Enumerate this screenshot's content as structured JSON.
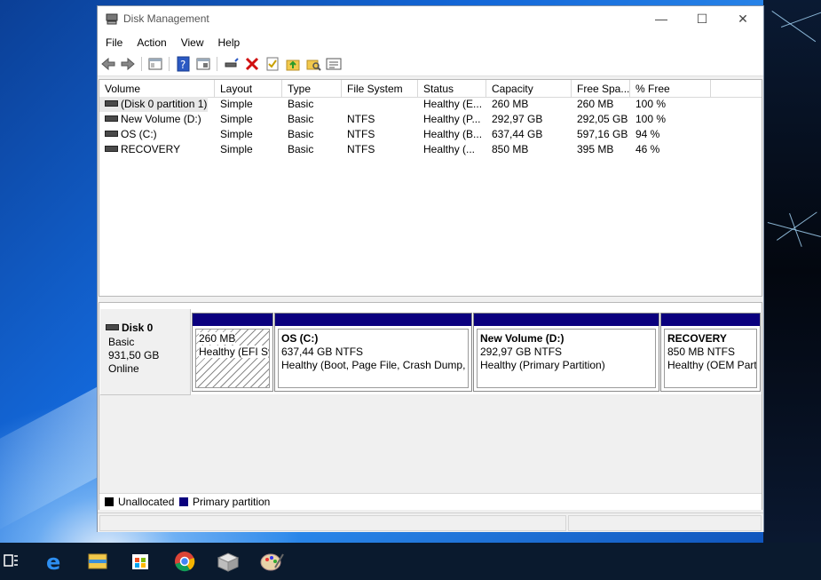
{
  "window": {
    "title": "Disk Management",
    "menu": [
      "File",
      "Action",
      "View",
      "Help"
    ]
  },
  "toolbar": {
    "icons": [
      "back-icon",
      "forward-icon",
      "console-tree-icon",
      "help-icon",
      "properties-icon",
      "connect-icon",
      "delete-icon",
      "check-icon",
      "folder-up-icon",
      "search-folder-icon",
      "list-icon"
    ]
  },
  "volume_list": {
    "columns": [
      "Volume",
      "Layout",
      "Type",
      "File System",
      "Status",
      "Capacity",
      "Free Spa...",
      "% Free"
    ],
    "rows": [
      {
        "volume": "(Disk 0 partition 1)",
        "layout": "Simple",
        "type": "Basic",
        "fs": "",
        "status": "Healthy (E...",
        "capacity": "260 MB",
        "free": "260 MB",
        "pct": "100 %"
      },
      {
        "volume": "New Volume (D:)",
        "layout": "Simple",
        "type": "Basic",
        "fs": "NTFS",
        "status": "Healthy (P...",
        "capacity": "292,97 GB",
        "free": "292,05 GB",
        "pct": "100 %"
      },
      {
        "volume": "OS (C:)",
        "layout": "Simple",
        "type": "Basic",
        "fs": "NTFS",
        "status": "Healthy (B...",
        "capacity": "637,44 GB",
        "free": "597,16 GB",
        "pct": "94 %"
      },
      {
        "volume": "RECOVERY",
        "layout": "Simple",
        "type": "Basic",
        "fs": "NTFS",
        "status": "Healthy (...",
        "capacity": "850 MB",
        "free": "395 MB",
        "pct": "46 %"
      }
    ]
  },
  "disk": {
    "name": "Disk 0",
    "type": "Basic",
    "size": "931,50 GB",
    "state": "Online"
  },
  "partitions": [
    {
      "name": "",
      "size": "260 MB",
      "status": "Healthy (EFI Sy"
    },
    {
      "name": "OS  (C:)",
      "size": "637,44 GB NTFS",
      "status": "Healthy (Boot, Page File, Crash Dump, P"
    },
    {
      "name": "New Volume  (D:)",
      "size": "292,97 GB NTFS",
      "status": "Healthy (Primary Partition)"
    },
    {
      "name": "RECOVERY",
      "size": "850 MB NTFS",
      "status": "Healthy (OEM Part"
    }
  ],
  "legend": {
    "unallocated": "Unallocated",
    "primary": "Primary partition",
    "unallocated_color": "#000000",
    "primary_color": "#0b007e"
  },
  "taskbar": {
    "icons": [
      "task-view-icon",
      "edge-icon",
      "file-explorer-icon",
      "store-icon",
      "chrome-icon",
      "app-box-icon",
      "paint-icon"
    ]
  }
}
